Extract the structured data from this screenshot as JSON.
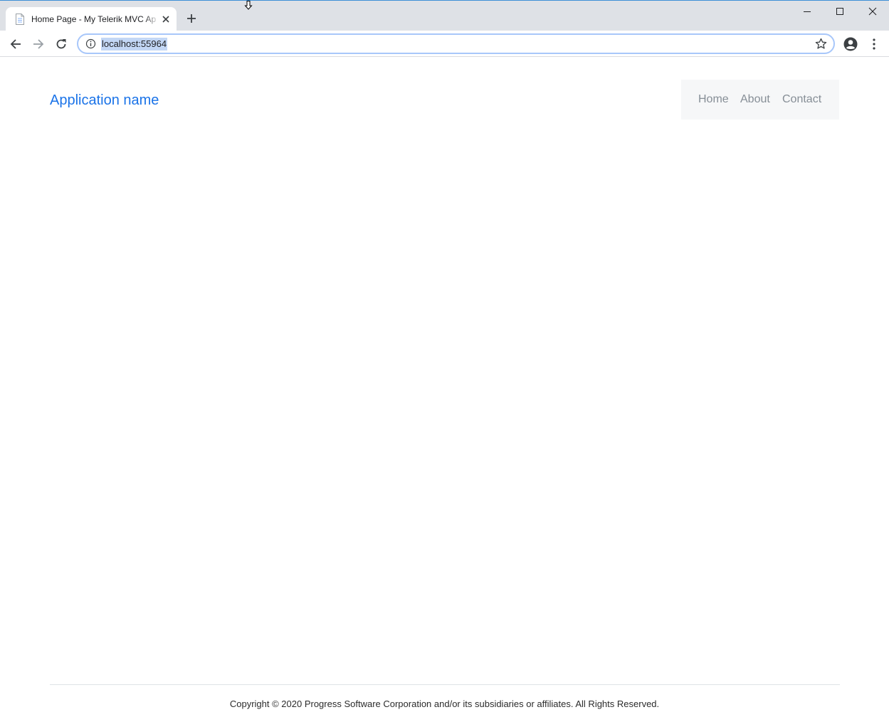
{
  "browser": {
    "tab": {
      "title": "Home Page - My Telerik MVC Ap"
    },
    "address_bar": {
      "url": "localhost:55964"
    },
    "icons": {
      "tab_favicon": "page-icon",
      "tab_close": "close-icon",
      "new_tab": "plus-icon",
      "back": "arrow-left-icon",
      "forward": "arrow-right-icon",
      "reload": "reload-icon",
      "site_info": "info-icon",
      "bookmark": "star-icon",
      "profile": "account-icon",
      "menu": "kebab-menu-icon",
      "minimize": "minimize-icon",
      "maximize": "maximize-icon",
      "close_window": "close-icon"
    },
    "colors": {
      "tabstrip": "#dee1e6",
      "url_selection": "#c3d7f5",
      "omnibox_focus": "#a8c7fa"
    }
  },
  "page": {
    "brand": "Application name",
    "nav": {
      "items": [
        "Home",
        "About",
        "Contact"
      ]
    },
    "footer": "Copyright © 2020 Progress Software Corporation and/or its subsidiaries or affiliates. All Rights Reserved.",
    "colors": {
      "brand": "#1a73e8",
      "nav_background": "#f6f7f8",
      "nav_text": "#868e96"
    }
  }
}
